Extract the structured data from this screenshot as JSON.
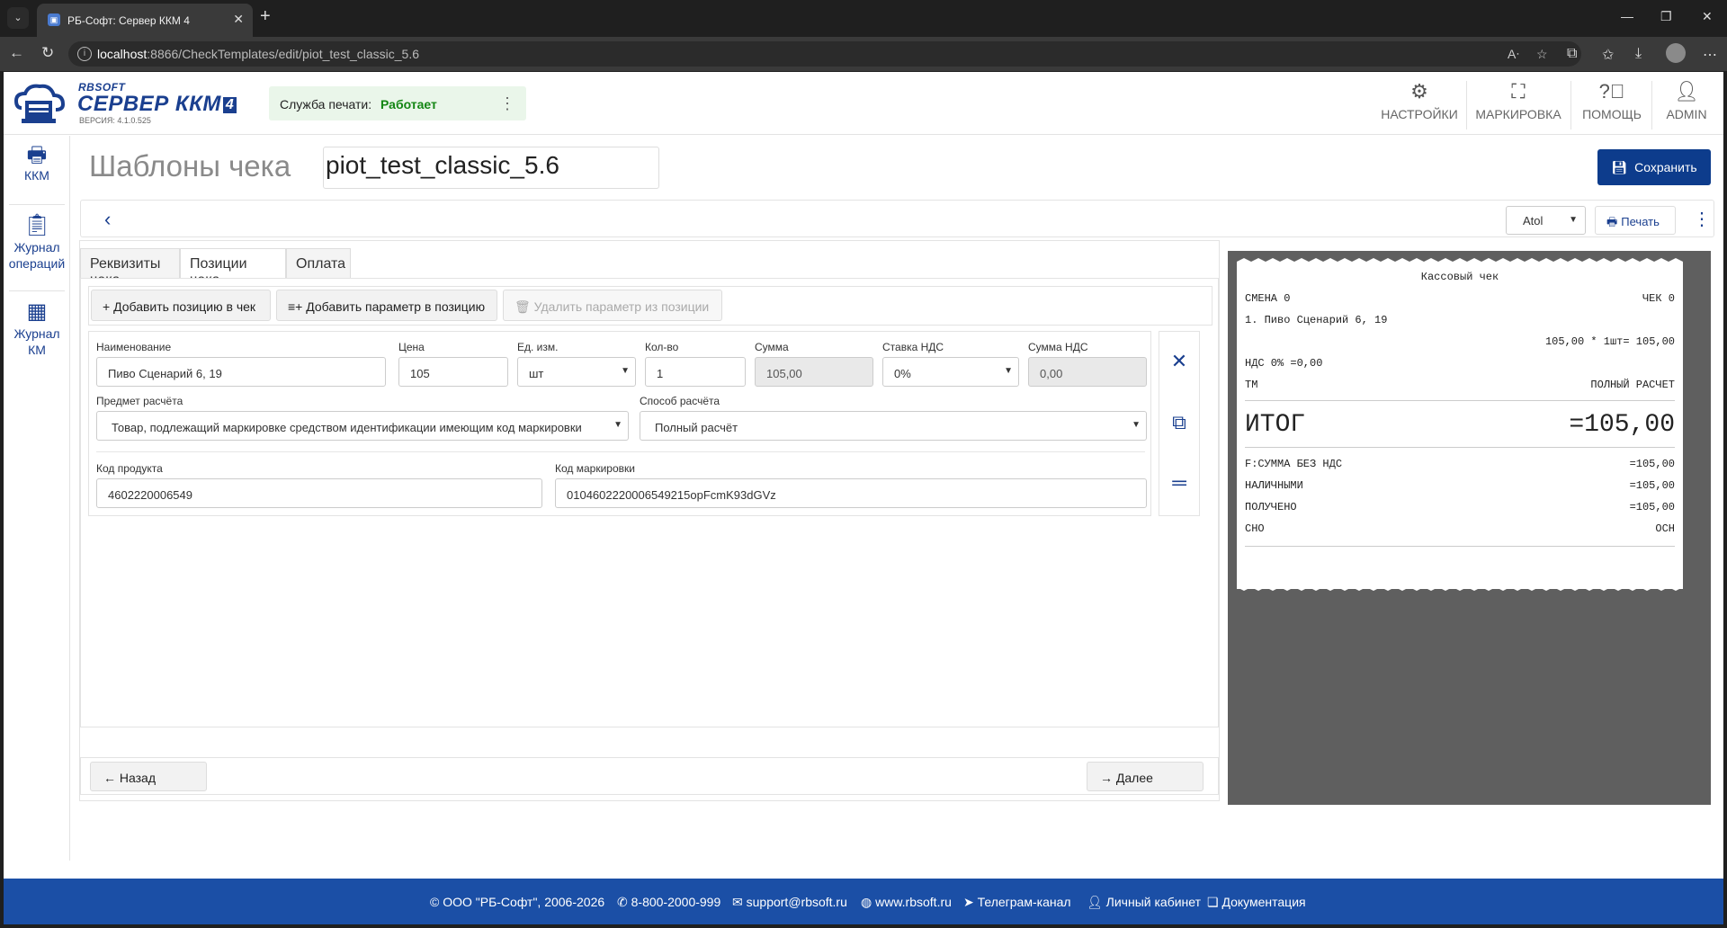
{
  "browser": {
    "tab_title": "РБ-Софт: Сервер ККМ 4",
    "url_host": "localhost",
    "url_rest": ":8866/CheckTemplates/edit/piot_test_classic_5.6"
  },
  "header": {
    "brand_small": "RBSOFT",
    "brand_big": "СЕРВЕР ККМ",
    "brand_num": "4",
    "version": "ВЕРСИЯ: 4.1.0.525",
    "service_label": "Служба печати:",
    "service_status": "Работает",
    "nav": [
      {
        "label": "НАСТРОЙКИ",
        "icon": "gear-icon"
      },
      {
        "label": "МАРКИРОВКА",
        "icon": "scan-icon"
      },
      {
        "label": "ПОМОЩЬ",
        "icon": "help-icon"
      },
      {
        "label": "ADMIN",
        "icon": "user-icon"
      }
    ]
  },
  "sidebar": {
    "items": [
      {
        "label": "ККМ",
        "icon": "printer-icon"
      },
      {
        "label": "Журнал операций",
        "line1": "Журнал",
        "line2": "операций",
        "icon": "clipboard-icon"
      },
      {
        "label": "Журнал КМ",
        "line1": "Журнал",
        "line2": "КМ",
        "icon": "qr-icon"
      }
    ]
  },
  "main": {
    "title": "Шаблоны чека",
    "template_name": "piot_test_classic_5.6",
    "save_label": "Сохранить",
    "printer_select": "Atol",
    "print_label": "Печать",
    "tabs": [
      {
        "label": "Реквизиты чека",
        "active": false
      },
      {
        "label": "Позиции чека",
        "active": true
      },
      {
        "label": "Оплата",
        "active": false
      }
    ],
    "actions": {
      "add_position": "Добавить позицию в чек",
      "add_param": "Добавить параметр в позицию",
      "remove_param": "Удалить параметр из позиции"
    },
    "position": {
      "name_label": "Наименование",
      "name_value": "Пиво Сценарий 6, 19",
      "price_label": "Цена",
      "price_value": "105",
      "unit_label": "Ед. изм.",
      "unit_value": "шт",
      "qty_label": "Кол-во",
      "qty_value": "1",
      "sum_label": "Сумма",
      "sum_value": "105,00",
      "vat_rate_label": "Ставка НДС",
      "vat_rate_value": "0%",
      "vat_sum_label": "Сумма НДС",
      "vat_sum_value": "0,00",
      "subject_label": "Предмет расчёта",
      "subject_value": "Товар, подлежащий маркировке средством идентификации имеющим код маркировки",
      "method_label": "Способ расчёта",
      "method_value": "Полный расчёт",
      "product_code_label": "Код продукта",
      "product_code_value": "4602220006549",
      "mark_code_label": "Код маркировки",
      "mark_code_value": "0104602220006549215opFcmK93dGVz"
    },
    "back_label": "Назад",
    "next_label": "Далее"
  },
  "receipt": {
    "title": "Кассовый чек",
    "shift": "СМЕНА 0",
    "check": "ЧЕК 0",
    "item": "1. Пиво Сценарий 6, 19",
    "calc": "105,00 * 1шт= 105,00",
    "vat": "НДС 0% =0,00",
    "tm": "ТМ",
    "payment_type": "ПОЛНЫЙ РАСЧЕТ",
    "total_label": "ИТОГ",
    "total_value": "=105,00",
    "rows": [
      {
        "l": "F:СУММА БЕЗ НДС",
        "r": "=105,00"
      },
      {
        "l": "НАЛИЧНЫМИ",
        "r": "=105,00"
      },
      {
        "l": "ПОЛУЧЕНО",
        "r": "=105,00"
      },
      {
        "l": "СНО",
        "r": "ОСН"
      }
    ]
  },
  "footer": {
    "copyright": "© ООО \"РБ-Софт\", 2006-2026",
    "phone": "8-800-2000-999",
    "email": "support@rbsoft.ru",
    "site": "www.rbsoft.ru",
    "telegram": "Телеграм-канал",
    "cabinet": "Личный кабинет",
    "docs": "Документация"
  },
  "colors": {
    "brand": "#1a3f8f",
    "status_ok": "#148614",
    "footer": "#1b4fa6"
  }
}
